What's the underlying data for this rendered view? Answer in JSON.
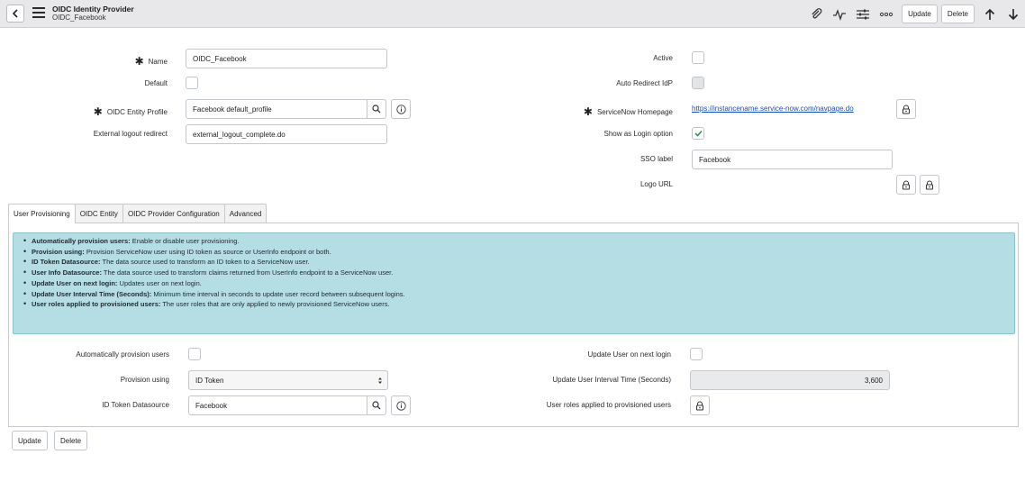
{
  "header": {
    "title": "OIDC Identity Provider",
    "subtitle": "OIDC_Facebook",
    "update_label": "Update",
    "delete_label": "Delete"
  },
  "form": {
    "name_label": "Name",
    "name_value": "OIDC_Facebook",
    "default_label": "Default",
    "entity_profile_label": "OIDC Entity Profile",
    "entity_profile_value": "Facebook default_profile",
    "logout_label": "External logout redirect",
    "logout_value": "external_logout_complete.do",
    "active_label": "Active",
    "auto_redirect_label": "Auto Redirect IdP",
    "homepage_label": "ServiceNow Homepage",
    "homepage_value": "https://instancename.service-now.com/navpage.do",
    "show_login_label": "Show as Login option",
    "sso_label_label": "SSO label",
    "sso_label_value": "Facebook",
    "logo_url_label": "Logo URL"
  },
  "tabs": [
    {
      "label": "User Provisioning"
    },
    {
      "label": "OIDC Entity"
    },
    {
      "label": "OIDC Provider Configuration"
    },
    {
      "label": "Advanced"
    }
  ],
  "info": [
    {
      "term": "Automatically provision users:",
      "desc": " Enable or disable user provisioning."
    },
    {
      "term": "Provision using:",
      "desc": " Provision ServiceNow user using ID token as source or UserInfo endpoint or both."
    },
    {
      "term": "ID Token Datasource:",
      "desc": " The data source used to transform an ID token to a ServiceNow user."
    },
    {
      "term": "User Info Datasource:",
      "desc": " The data source used to transform claims returned from UserInfo endpoint to a ServiceNow user."
    },
    {
      "term": "Update User on next login:",
      "desc": " Updates user on next login."
    },
    {
      "term": "Update User Interval Time (Seconds):",
      "desc": " Minimum time interval in seconds to update user record between subsequent logins."
    },
    {
      "term": "User roles applied to provisioned users:",
      "desc": " The user roles that are only applied to newly provisioned ServiceNow users."
    }
  ],
  "provisioning": {
    "auto_provision_label": "Automatically provision users",
    "provision_using_label": "Provision using",
    "provision_using_value": "ID Token",
    "id_token_ds_label": "ID Token Datasource",
    "id_token_ds_value": "Facebook",
    "update_next_login_label": "Update User on next login",
    "interval_label": "Update User Interval Time (Seconds)",
    "interval_value": "3,600",
    "roles_label": "User roles applied to provisioned users"
  },
  "footer": {
    "update_label": "Update",
    "delete_label": "Delete"
  },
  "colors": {
    "info_bg": "#b5dde4",
    "link": "#1a4fbf",
    "check": "#2e8b57"
  }
}
